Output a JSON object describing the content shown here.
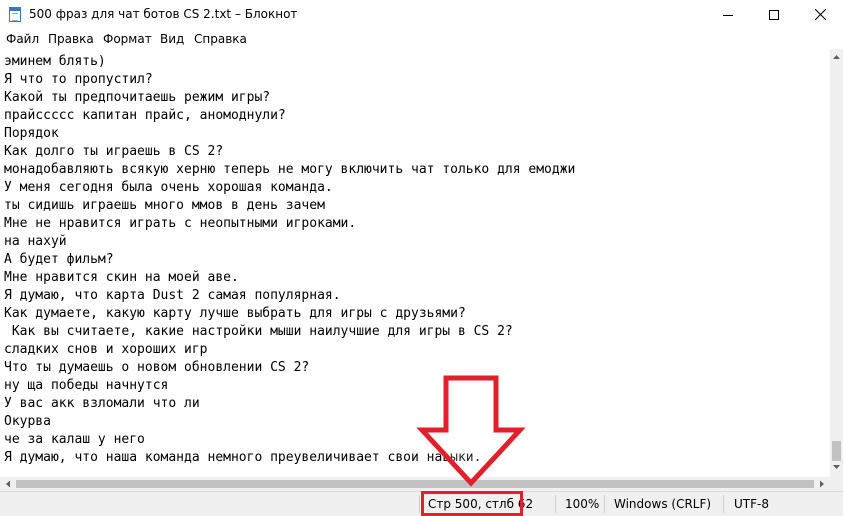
{
  "window": {
    "title": "500 фраз для чат ботов CS 2.txt – Блокнот",
    "controls": [
      "minimize",
      "maximize",
      "close"
    ]
  },
  "menu": {
    "items": [
      "Файл",
      "Правка",
      "Формат",
      "Вид",
      "Справка"
    ]
  },
  "editor": {
    "lines": [
      "эминем блять)",
      "Я что то пропустил?",
      "Какой ты предпочитаешь режим игры?",
      "прайсcccc капитан прайс, аномоднули?",
      "Порядок",
      "Как долго ты играешь в CS 2?",
      "монадобавляють всякую херню теперь не могу включить чат только для емоджи",
      "У меня сегодня была очень хорошая команда.",
      "ты сидишь играешь много ммов в день зачем",
      "Мне не нравится играть с неопытными игроками.",
      "на нахуй",
      "А будет фильм?",
      "Мне нравится скин на моей аве.",
      "Я думаю, что карта Dust 2 самая популярная.",
      "Как думаете, какую карту лучше выбрать для игры с друзьями?",
      " Как вы считаете, какие настройки мыши наилучшие для игры в CS 2?",
      "сладких снов и хороших игр",
      "Что ты думаешь о новом обновлении CS 2?",
      "ну ща победы начнутся",
      "У вас акк взломали что ли",
      "Окурва",
      "че за калаш у него",
      "Я думаю, что наша команда немного преувеличивает свои навыки."
    ]
  },
  "status": {
    "position": "Стр 500, стлб 62",
    "zoom": "100%",
    "line_endings": "Windows (CRLF)",
    "encoding": "UTF-8"
  },
  "annotation": {
    "arrow_color": "#e0202a"
  }
}
